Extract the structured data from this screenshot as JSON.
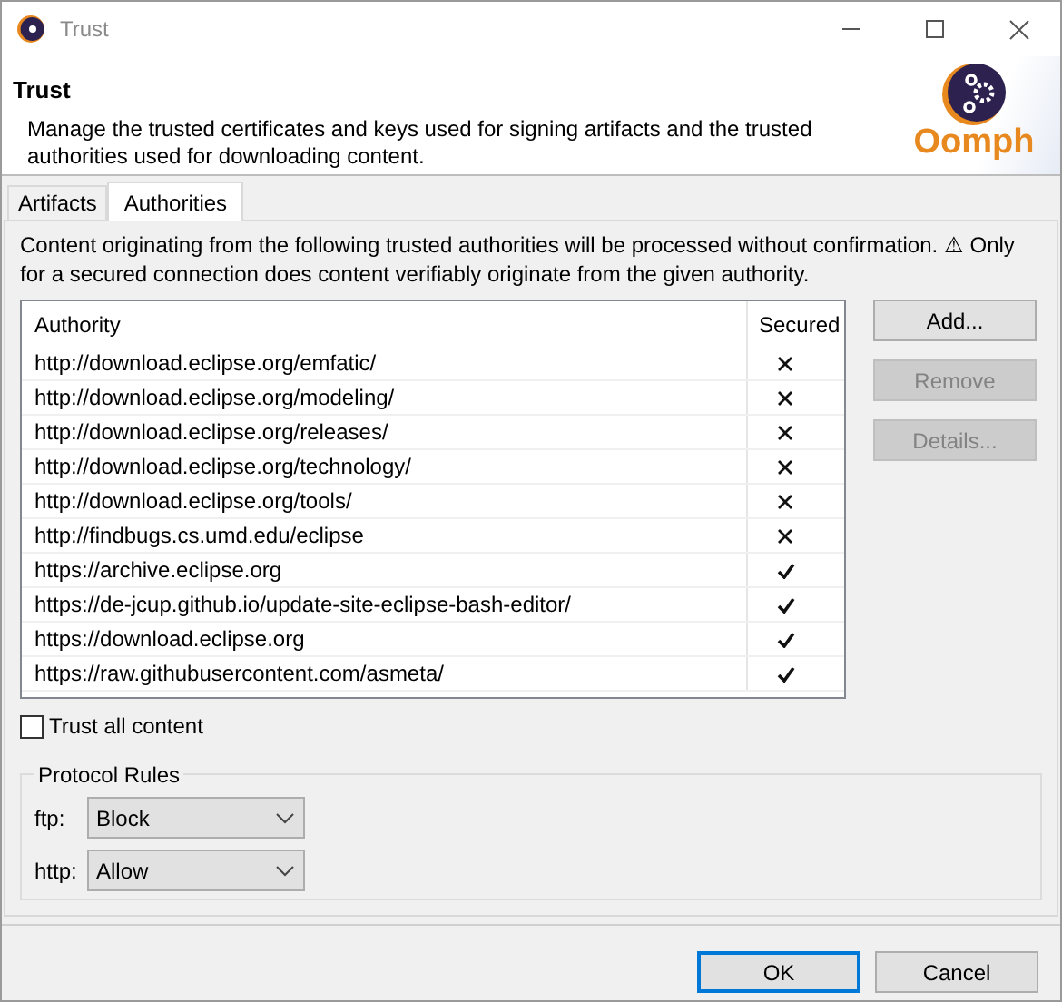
{
  "window": {
    "title": "Trust"
  },
  "header": {
    "title": "Trust",
    "description": "Manage the trusted certificates and keys used for signing artifacts and the trusted authorities used for downloading content.",
    "logo": "Oomph"
  },
  "tabs": [
    {
      "label": "Artifacts",
      "selected": false
    },
    {
      "label": "Authorities",
      "selected": true
    }
  ],
  "intro": "Content originating from the following trusted authorities will be processed without confirmation. ⚠ Only for a secured connection does content verifiably originate from the given authority.",
  "table": {
    "columns": [
      "Authority",
      "Secured"
    ],
    "rows": [
      {
        "authority": "http://download.eclipse.org/emfatic/",
        "secured": false
      },
      {
        "authority": "http://download.eclipse.org/modeling/",
        "secured": false
      },
      {
        "authority": "http://download.eclipse.org/releases/",
        "secured": false
      },
      {
        "authority": "http://download.eclipse.org/technology/",
        "secured": false
      },
      {
        "authority": "http://download.eclipse.org/tools/",
        "secured": false
      },
      {
        "authority": "http://findbugs.cs.umd.edu/eclipse",
        "secured": false
      },
      {
        "authority": "https://archive.eclipse.org",
        "secured": true
      },
      {
        "authority": "https://de-jcup.github.io/update-site-eclipse-bash-editor/",
        "secured": true
      },
      {
        "authority": "https://download.eclipse.org",
        "secured": true
      },
      {
        "authority": "https://raw.githubusercontent.com/asmeta/",
        "secured": true
      }
    ]
  },
  "side_buttons": [
    {
      "label": "Add...",
      "disabled": false
    },
    {
      "label": "Remove",
      "disabled": true
    },
    {
      "label": "Details...",
      "disabled": true
    }
  ],
  "trust_all": {
    "label": "Trust all content",
    "checked": false
  },
  "protocol_rules": {
    "title": "Protocol Rules",
    "rules": [
      {
        "label": "ftp:",
        "value": "Block"
      },
      {
        "label": "http:",
        "value": "Allow"
      }
    ]
  },
  "footer_buttons": [
    {
      "label": "OK",
      "default": true
    },
    {
      "label": "Cancel",
      "default": false
    }
  ]
}
